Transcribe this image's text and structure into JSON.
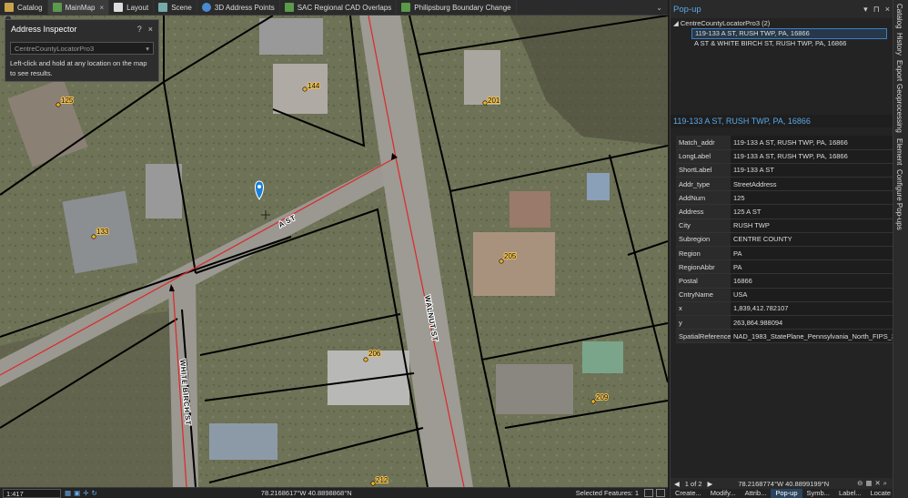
{
  "tabs": [
    {
      "label": "Catalog",
      "icon": "catalog-icon",
      "active": false,
      "closable": false
    },
    {
      "label": "MainMap",
      "icon": "map-icon",
      "active": true,
      "closable": true
    },
    {
      "label": "Layout",
      "icon": "layout-icon",
      "active": false,
      "closable": false
    },
    {
      "label": "Scene",
      "icon": "scene-icon",
      "active": false,
      "closable": false
    },
    {
      "label": "3D Address Points",
      "icon": "globe-icon",
      "active": false,
      "closable": false
    },
    {
      "label": "SAC Regional CAD Overlaps",
      "icon": "map-icon",
      "active": false,
      "closable": false
    },
    {
      "label": "Philipsburg Boundary Change",
      "icon": "map-icon",
      "active": false,
      "closable": false
    }
  ],
  "inspector": {
    "title": "Address Inspector",
    "help_button": "?",
    "close_button": "×",
    "locator_value": "CentreCountyLocatorPro3",
    "help_text": "Left-click and hold at any location on the map to see results."
  },
  "map": {
    "address_points": [
      "125",
      "144",
      "201",
      "133",
      "205",
      "206",
      "209",
      "212"
    ],
    "street_labels": [
      "A ST",
      "WALNUT ST",
      "WHITE BIRCH ST"
    ]
  },
  "status": {
    "scale": "1:417",
    "coordinates": "78.2168617°W 40.8898868°N",
    "selected_features": "Selected Features: 1"
  },
  "popup": {
    "title": "Pop-up",
    "group_label": "CentreCountyLocatorPro3 (2)",
    "results": [
      {
        "label": "119-133 A ST, RUSH TWP, PA, 16866",
        "selected": true
      },
      {
        "label": "A ST & WHITE BIRCH ST, RUSH TWP, PA, 16866",
        "selected": false
      }
    ],
    "feature_title": "119-133 A ST, RUSH TWP, PA, 16866",
    "attributes": [
      {
        "key": "Match_addr",
        "value": "119-133 A ST, RUSH TWP, PA, 16866"
      },
      {
        "key": "LongLabel",
        "value": "119-133 A ST, RUSH TWP, PA, 16866"
      },
      {
        "key": "ShortLabel",
        "value": "119-133 A ST"
      },
      {
        "key": "Addr_type",
        "value": "StreetAddress"
      },
      {
        "key": "AddNum",
        "value": "125"
      },
      {
        "key": "Address",
        "value": "125 A ST"
      },
      {
        "key": "City",
        "value": "RUSH TWP"
      },
      {
        "key": "Subregion",
        "value": "CENTRE COUNTY"
      },
      {
        "key": "Region",
        "value": "PA"
      },
      {
        "key": "RegionAbbr",
        "value": "PA"
      },
      {
        "key": "Postal",
        "value": "16866"
      },
      {
        "key": "CntryName",
        "value": "USA"
      },
      {
        "key": "x",
        "value": "1,839,412.782107"
      },
      {
        "key": "y",
        "value": "263,864.988094"
      },
      {
        "key": "SpatialReference",
        "value": "NAD_1983_StatePlane_Pennsylvania_North_FIPS_370"
      }
    ],
    "pager": "1 of 2",
    "footer_coordinates": "78.2168774°W 40.8899199°N",
    "bottom_tabs": [
      "Create...",
      "Modify...",
      "Attrib...",
      "Pop-up",
      "Symb...",
      "Label...",
      "Locate"
    ],
    "active_bottom_tab": "Pop-up"
  },
  "right_rail": [
    "Catalog",
    "History",
    "Export",
    "Geoprocessing",
    "Element",
    "Configure Pop-ups"
  ],
  "colors": {
    "accent": "#5aa8e6",
    "road_centerline": "#e0262a",
    "parcel_line": "#000000",
    "address_point": "#f0b020",
    "pin": "#1a7fd8"
  }
}
